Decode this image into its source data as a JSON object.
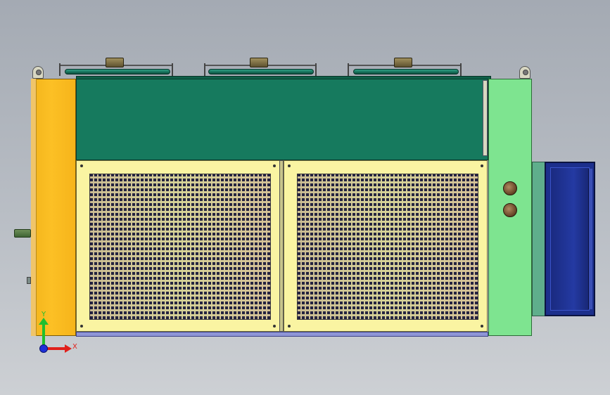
{
  "axis_triad": {
    "y_label": "Y",
    "x_label": "X",
    "colors": {
      "x": "#e0201c",
      "y": "#1fbf2f",
      "z": "#1d2fd8"
    }
  },
  "palette": {
    "background": "#b9bec5",
    "orange_module": "#fcc025",
    "green_body": "#167a5e",
    "grille_panel": "#faf4a2",
    "right_module": "#7ee490",
    "motor": "#1c2f8c",
    "bottom_rail": "#8e95d6"
  },
  "components": {
    "fans": [
      "fan-1",
      "fan-2",
      "fan-3"
    ],
    "grilles": [
      "left-grille",
      "right-grille"
    ],
    "knobs": [
      "knob-upper",
      "knob-lower"
    ]
  }
}
